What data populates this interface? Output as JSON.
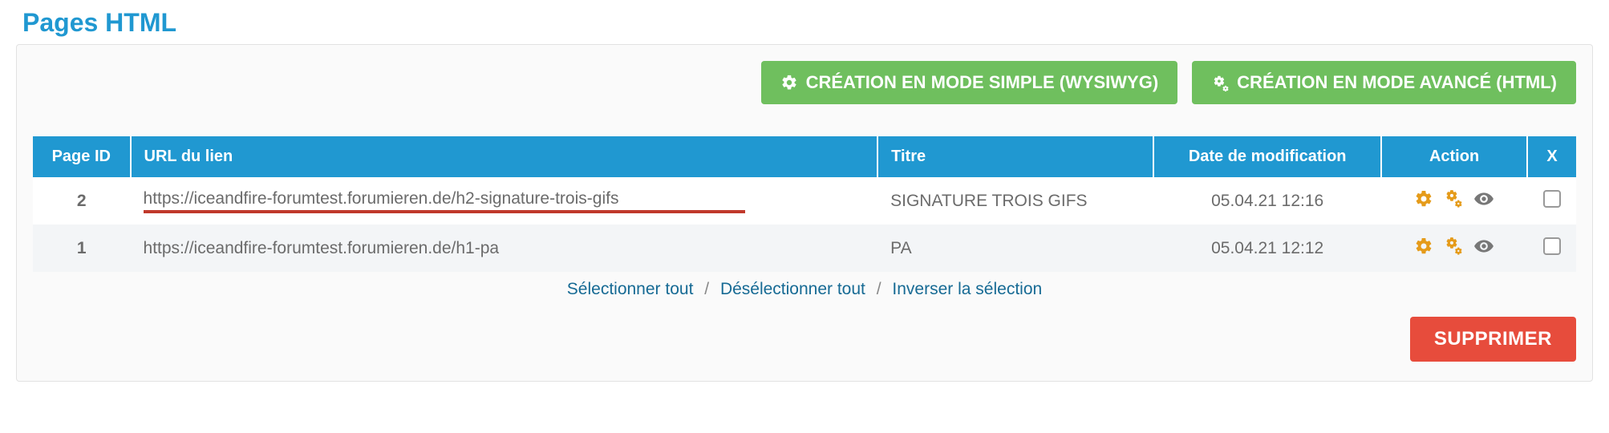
{
  "page_title": "Pages HTML",
  "buttons": {
    "create_simple": "CRÉATION EN MODE SIMPLE (WYSIWYG)",
    "create_advanced": "CRÉATION EN MODE AVANCÉ (HTML)",
    "delete": "SUPPRIMER"
  },
  "table": {
    "headers": {
      "page_id": "Page ID",
      "url": "URL du lien",
      "title": "Titre",
      "modified": "Date de modification",
      "action": "Action",
      "x": "X"
    },
    "rows": [
      {
        "id": "2",
        "url": "https://iceandfire-forumtest.forumieren.de/h2-signature-trois-gifs",
        "title": "SIGNATURE TROIS GIFS",
        "modified": "05.04.21 12:16",
        "highlight": true
      },
      {
        "id": "1",
        "url": "https://iceandfire-forumtest.forumieren.de/h1-pa",
        "title": "PA",
        "modified": "05.04.21 12:12",
        "highlight": false
      }
    ]
  },
  "select_links": {
    "select_all": "Sélectionner tout",
    "deselect_all": "Désélectionner tout",
    "invert": "Inverser la sélection"
  }
}
